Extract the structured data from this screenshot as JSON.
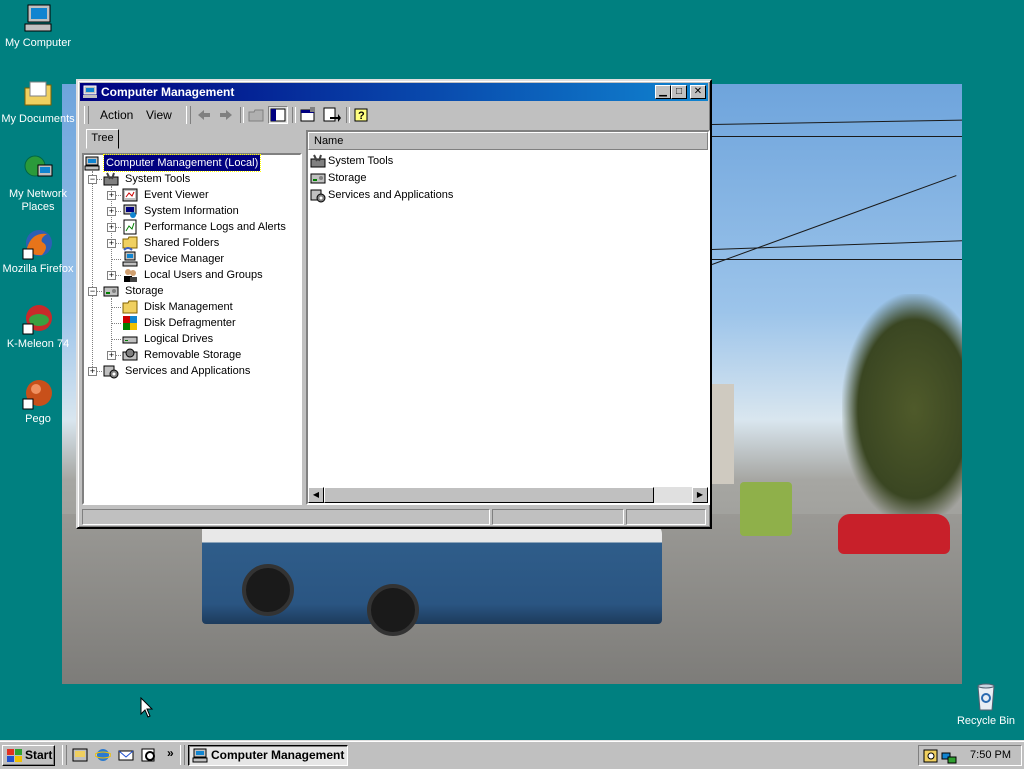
{
  "desktop": {
    "icons": [
      {
        "label": "My Computer",
        "icon": "my-computer-icon"
      },
      {
        "label": "My Documents",
        "icon": "folder-icon"
      },
      {
        "label": "My Network Places",
        "icon": "network-icon"
      },
      {
        "label": "Mozilla Firefox",
        "icon": "firefox-icon"
      },
      {
        "label": "K-Meleon 74",
        "icon": "k-meleon-icon"
      },
      {
        "label": "Pego",
        "icon": "pego-icon"
      },
      {
        "label": "Recycle Bin",
        "icon": "recycle-bin-icon"
      }
    ],
    "background_color": "#008080"
  },
  "window": {
    "title": "Computer Management",
    "menu": {
      "action": "Action",
      "view": "View"
    },
    "tab_label": "Tree",
    "tree": [
      {
        "label": "Computer Management (Local)",
        "icon": "computer-management-icon",
        "selected": true
      },
      {
        "label": "System Tools",
        "icon": "tools-icon"
      },
      {
        "label": "Event Viewer",
        "icon": "event-viewer-icon"
      },
      {
        "label": "System Information",
        "icon": "system-info-icon"
      },
      {
        "label": "Performance Logs and Alerts",
        "icon": "performance-icon"
      },
      {
        "label": "Shared Folders",
        "icon": "shared-folder-icon"
      },
      {
        "label": "Device Manager",
        "icon": "device-manager-icon"
      },
      {
        "label": "Local Users and Groups",
        "icon": "users-icon"
      },
      {
        "label": "Storage",
        "icon": "storage-icon"
      },
      {
        "label": "Disk Management",
        "icon": "disk-management-icon"
      },
      {
        "label": "Disk Defragmenter",
        "icon": "defrag-icon"
      },
      {
        "label": "Logical Drives",
        "icon": "drive-icon"
      },
      {
        "label": "Removable Storage",
        "icon": "removable-storage-icon"
      },
      {
        "label": "Services and Applications",
        "icon": "services-icon"
      }
    ],
    "list_header": "Name",
    "list": [
      {
        "label": "System Tools",
        "icon": "tools-icon"
      },
      {
        "label": "Storage",
        "icon": "storage-icon"
      },
      {
        "label": "Services and Applications",
        "icon": "services-icon"
      }
    ]
  },
  "taskbar": {
    "start_label": "Start",
    "task_label": "Computer Management",
    "clock": "7:50 PM"
  },
  "colors": {
    "title_active_start": "#000080",
    "title_active_end": "#1084d0",
    "face": "#c0c0c0",
    "selection": "#000080"
  }
}
